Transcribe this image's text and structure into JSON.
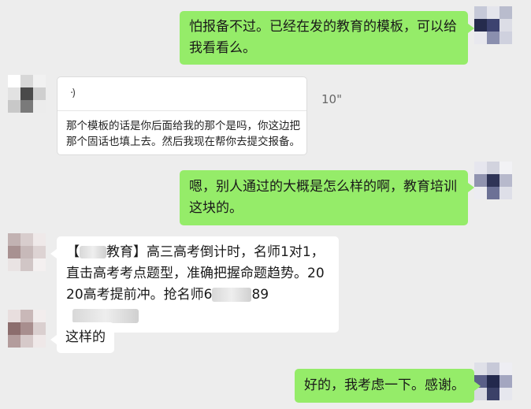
{
  "chat": {
    "messages": [
      {
        "side": "out",
        "text": "怕报备不过。已经在发的教育的模板，可以给我看看么。"
      },
      {
        "side": "in",
        "type": "voice",
        "duration": "10\"",
        "transcript": "那个模板的话是你后面给我的那个是吗，你这边把那个固话也填上去。然后我现在帮你去提交报备。"
      },
      {
        "side": "out",
        "text": "嗯，别人通过的大概是怎么样的啊，教育培训这块的。"
      },
      {
        "side": "in",
        "text_a": "【",
        "text_b": "教育】高三高考倒计时，名师1对1，直击高考考点题型，准确把握命题趋势。2020高考提前冲。抢名师",
        "text_c": "6",
        "text_d": "89"
      },
      {
        "side": "in",
        "text": "这样的"
      },
      {
        "side": "out",
        "text": "好的，我考虑一下。感谢。"
      }
    ]
  },
  "colors": {
    "background": "#ededed",
    "outgoing": "#95ec69",
    "incoming": "#ffffff"
  },
  "icons": {
    "voice": "voice-wave-icon"
  }
}
